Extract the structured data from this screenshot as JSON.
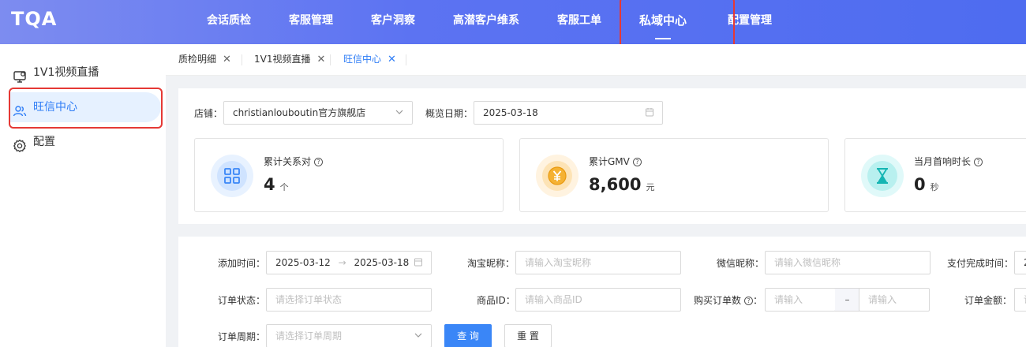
{
  "app": {
    "logo": "TQA"
  },
  "nav": [
    {
      "label": "会话质检"
    },
    {
      "label": "客服管理"
    },
    {
      "label": "客户洞察"
    },
    {
      "label": "高潜客户维系"
    },
    {
      "label": "客服工单"
    },
    {
      "label": "私域中心",
      "active": true
    },
    {
      "label": "配置管理"
    }
  ],
  "sidebar": {
    "items": [
      {
        "label": "1V1视频直播",
        "icon": "monitor-icon"
      },
      {
        "label": "旺信中心",
        "icon": "users-icon",
        "active": true
      },
      {
        "label": "配置",
        "icon": "gear-icon"
      }
    ]
  },
  "tabs": [
    {
      "label": "质检明细",
      "close": "✕"
    },
    {
      "label": "1V1视频直播",
      "close": "✕"
    },
    {
      "label": "旺信中心",
      "close": "✕",
      "active": true
    }
  ],
  "overview": {
    "shop_label": "店铺：",
    "shop_value": "christianlouboutin官方旗舰店",
    "date_label": "概览日期：",
    "date_value": "2025-03-18"
  },
  "cards": [
    {
      "label": "累计关系对",
      "value": "4",
      "unit": "个",
      "icon": "grid-icon",
      "color": "#3a86f7",
      "bg": "#e8f2ff"
    },
    {
      "label": "累计GMV",
      "value": "8,600",
      "unit": "元",
      "icon": "yen-icon",
      "color": "#f5a623",
      "bg": "#fff3e0"
    },
    {
      "label": "当月首响时长",
      "value": "0",
      "unit": "秒",
      "icon": "hourglass-icon",
      "color": "#1bc3c3",
      "bg": "#e0f9f9"
    }
  ],
  "filters": {
    "add_time_label": "添加时间：",
    "add_time_start": "2025-03-12",
    "add_time_end": "2025-03-18",
    "taobao_nick_label": "淘宝昵称：",
    "taobao_nick_placeholder": "请输入淘宝昵称",
    "wechat_nick_label": "微信昵称：",
    "wechat_nick_placeholder": "请输入微信昵称",
    "pay_time_label": "支付完成时间：",
    "pay_time_value": "2",
    "order_status_label": "订单状态：",
    "order_status_placeholder": "请选择订单状态",
    "product_id_label": "商品ID：",
    "product_id_placeholder": "请输入商品ID",
    "buy_count_label": "购买订单数",
    "buy_count_min_placeholder": "请输入",
    "buy_count_sep": "–",
    "buy_count_max_placeholder": "请输入",
    "order_amount_label": "订单金额：",
    "order_amount_value": "请",
    "order_cycle_label": "订单周期：",
    "order_cycle_placeholder": "请选择订单周期",
    "query_label": "查 询",
    "reset_label": "重 置"
  }
}
